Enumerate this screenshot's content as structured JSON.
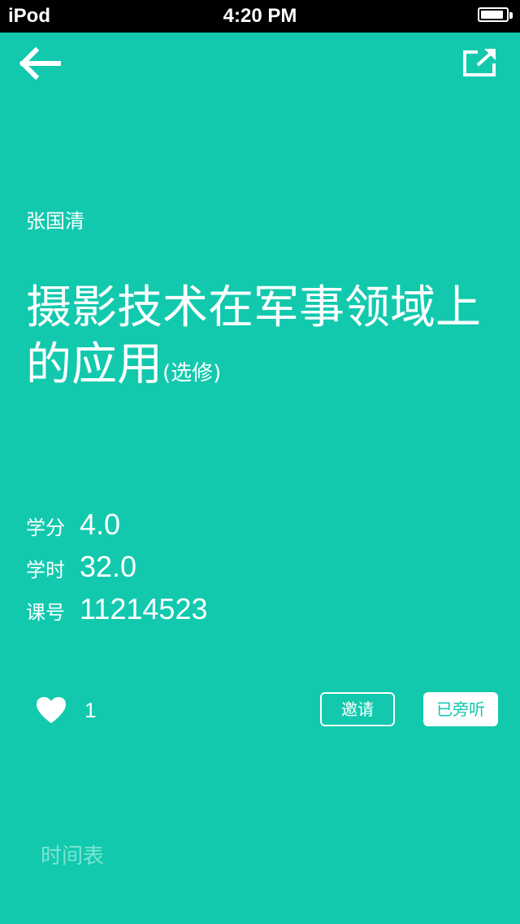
{
  "status_bar": {
    "carrier": "iPod",
    "time": "4:20 PM",
    "battery_level": 0.9
  },
  "nav": {
    "back_icon": "arrow-left-icon",
    "share_icon": "share-icon"
  },
  "course": {
    "teacher": "张国清",
    "title": "摄影技术在军事领域上的应用",
    "tag": "(选修)",
    "info": [
      {
        "label": "学分",
        "value": "4.0"
      },
      {
        "label": "学时",
        "value": "32.0"
      },
      {
        "label": "课号",
        "value": "11214523"
      }
    ]
  },
  "actions": {
    "like_icon": "heart-icon",
    "like_count": "1",
    "invite_label": "邀请",
    "audit_label": "已旁听"
  },
  "footer": {
    "schedule_label": "时间表"
  },
  "colors": {
    "background": "#12c9ae",
    "foreground": "#ffffff",
    "muted": "#7fe3d3"
  }
}
